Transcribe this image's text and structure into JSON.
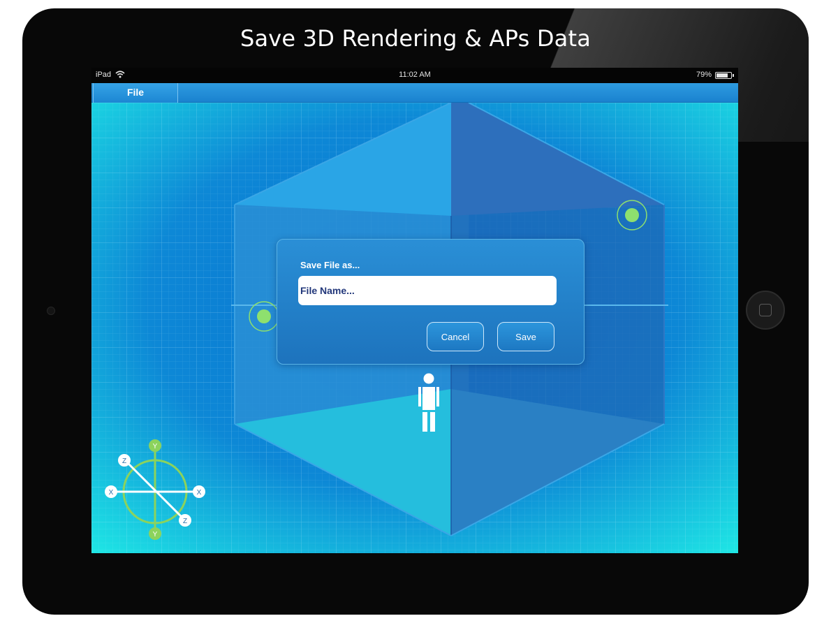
{
  "device": {
    "title": "Save 3D Rendering & APs Data"
  },
  "statusbar": {
    "device_name": "iPad",
    "time": "11:02 AM",
    "battery_percent": "79%",
    "battery_level": 0.79
  },
  "menu": {
    "file_label": "File"
  },
  "dialog": {
    "title": "Save File as...",
    "file_name_placeholder": "File Name...",
    "file_name_value": "",
    "cancel_label": "Cancel",
    "save_label": "Save"
  },
  "axis_gizmo": {
    "labels": {
      "y_top": "Y",
      "y_bottom": "Y",
      "x_left": "X",
      "x_right": "X",
      "z_top": "Z",
      "z_bottom": "Z"
    }
  },
  "colors": {
    "accent_blue": "#1f85d0",
    "canvas_cyan": "#1be8e4",
    "ap_green": "#8ee06e",
    "gizmo_green": "#8cd35c"
  },
  "icons": {
    "wifi": "wifi-icon",
    "battery": "battery-icon",
    "person": "person-icon",
    "access_point": "access-point-icon"
  }
}
